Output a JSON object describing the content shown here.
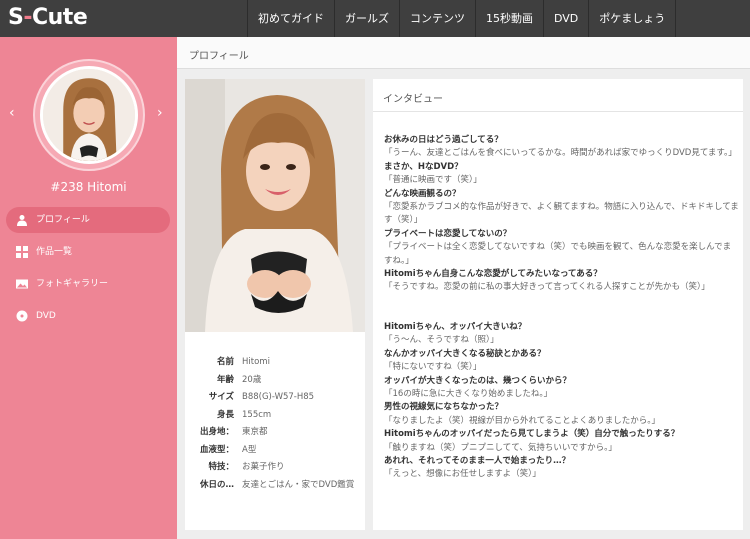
{
  "header": {
    "logo_s": "S",
    "logo_dash": "-",
    "logo_rest": "Cute",
    "nav": [
      "初めてガイド",
      "ガールズ",
      "コンテンツ",
      "15秒動画",
      "DVD",
      "ポケましょう"
    ]
  },
  "sidebar": {
    "prev_arrow": "‹",
    "next_arrow": "›",
    "name": "#238 Hitomi",
    "menu": [
      {
        "label": "プロフィール",
        "icon": "person-icon"
      },
      {
        "label": "作品一覧",
        "icon": "grid-icon"
      },
      {
        "label": "フォトギャラリー",
        "icon": "photo-icon"
      },
      {
        "label": "DVD",
        "icon": "disc-icon"
      }
    ]
  },
  "main": {
    "title": "プロフィール"
  },
  "profile": {
    "rows": [
      {
        "k": "名前",
        "v": "Hitomi"
      },
      {
        "k": "年齢",
        "v": "20歳"
      },
      {
        "k": "サイズ",
        "v": "B88(G)-W57-H85"
      },
      {
        "k": "身長",
        "v": "155cm"
      },
      {
        "k": "出身地：",
        "v": "東京都"
      },
      {
        "k": "血液型：",
        "v": "A型"
      },
      {
        "k": "特技：",
        "v": "お菓子作り"
      },
      {
        "k": "休日の…",
        "v": "友達とごはん・家でDVD鑑賞"
      }
    ]
  },
  "interview": {
    "title": "インタビュー",
    "block1": [
      {
        "q": "お休みの日はどう過ごしてる？",
        "a": "「うーん、友達とごはんを食べにいってるかな。時間があれば家でゆっくりDVD見てます。」"
      },
      {
        "q": "まさか、HなDVD？",
        "a": "「普通に映画です（笑）」"
      },
      {
        "q": "どんな映画観るの？",
        "a": "「恋愛系かラブコメ的な作品が好きで、よく観てますね。物語に入り込んで、ドキドキしてます（笑）」"
      },
      {
        "q": "プライベートは恋愛してないの？",
        "a": "「プライベートは全く恋愛してないですね（笑）でも映画を観て、色んな恋愛を楽しんでますね。」"
      },
      {
        "q": "Hitomiちゃん自身こんな恋愛がしてみたいなってある？",
        "a": "「そうですね。恋愛の前に私の事大好きって言ってくれる人探すことが先かも（笑）」"
      }
    ],
    "block2": [
      {
        "q": "Hitomiちゃん、オッパイ大きいね？",
        "a": "「う〜ん、そうですね（照）」"
      },
      {
        "q": "なんかオッパイ大きくなる秘訣とかある？",
        "a": "「特にないですね（笑）」"
      },
      {
        "q": "オッパイが大きくなったのは、幾つくらいから？",
        "a": "「16の時に急に大きくなり始めましたね。」"
      },
      {
        "q": "男性の視線気になちなかった？",
        "a": "「なりましたよ（笑）視線が目から外れてることよくありましたから。」"
      },
      {
        "q": "Hitomiちゃんのオッパイだったら見てしまうよ（笑）自分で触ったりする？",
        "a": "「触りますね（笑）プニプニしてて、気持ちいいですから。」"
      },
      {
        "q": "あれれ、それってそのまま一人で始まったり…？",
        "a": "「えっと、想像にお任せしますよ（笑）」"
      }
    ]
  }
}
